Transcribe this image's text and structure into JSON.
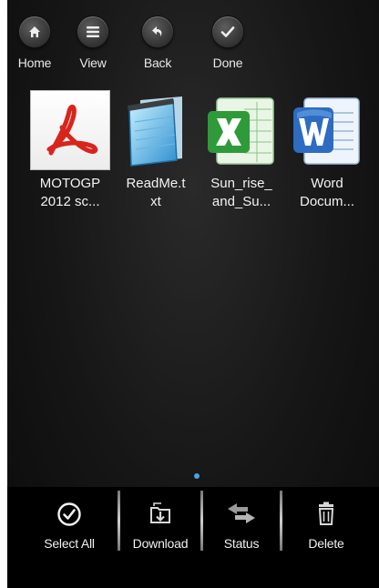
{
  "toolbar": {
    "items": [
      {
        "label": "Home",
        "icon": "home-icon"
      },
      {
        "label": "View",
        "icon": "list-icon"
      },
      {
        "label": "Back",
        "icon": "back-arrow-icon"
      },
      {
        "label": "Done",
        "icon": "checkmark-icon"
      }
    ]
  },
  "files": [
    {
      "name": "MOTOGP\n2012 sc...",
      "icon": "pdf-file-icon"
    },
    {
      "name": "ReadMe.t\nxt",
      "icon": "text-file-icon"
    },
    {
      "name": "Sun_rise_\nand_Su...",
      "icon": "excel-file-icon"
    },
    {
      "name": "Word\nDocum...",
      "icon": "word-file-icon"
    }
  ],
  "bottom_bar": {
    "items": [
      {
        "label": "Select All",
        "icon": "select-all-check-icon"
      },
      {
        "label": "Download",
        "icon": "download-icon"
      },
      {
        "label": "Status",
        "icon": "status-arrows-icon"
      },
      {
        "label": "Delete",
        "icon": "trash-icon"
      }
    ]
  },
  "page_indicator": {
    "accent": "#4aa3e8"
  }
}
